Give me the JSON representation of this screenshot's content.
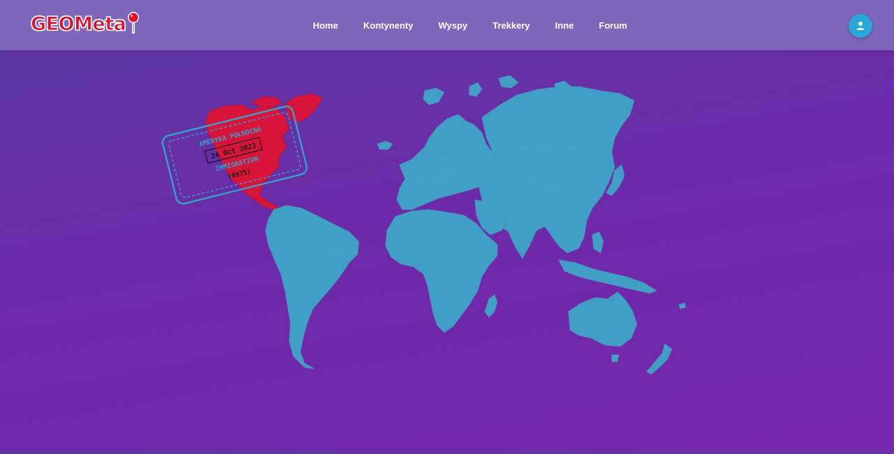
{
  "brand": {
    "name": "GEOMeta",
    "accent": "#e0102d"
  },
  "nav": {
    "items": [
      {
        "label": "Home"
      },
      {
        "label": "Kontynenty"
      },
      {
        "label": "Wyspy"
      },
      {
        "label": "Trekkery"
      },
      {
        "label": "Inne"
      },
      {
        "label": "Forum"
      }
    ]
  },
  "user": {
    "icon": "user-icon",
    "color": "#28a8d8"
  },
  "map": {
    "highlighted_region": "North America",
    "land_color": "#3f9fc4",
    "highlight_color": "#d8143a",
    "stamp": {
      "region": "AMERYKA PÓŁNOCNA",
      "date": "24 Oct 2023",
      "label": "IMMIGRATION",
      "code": "(0975)"
    }
  }
}
